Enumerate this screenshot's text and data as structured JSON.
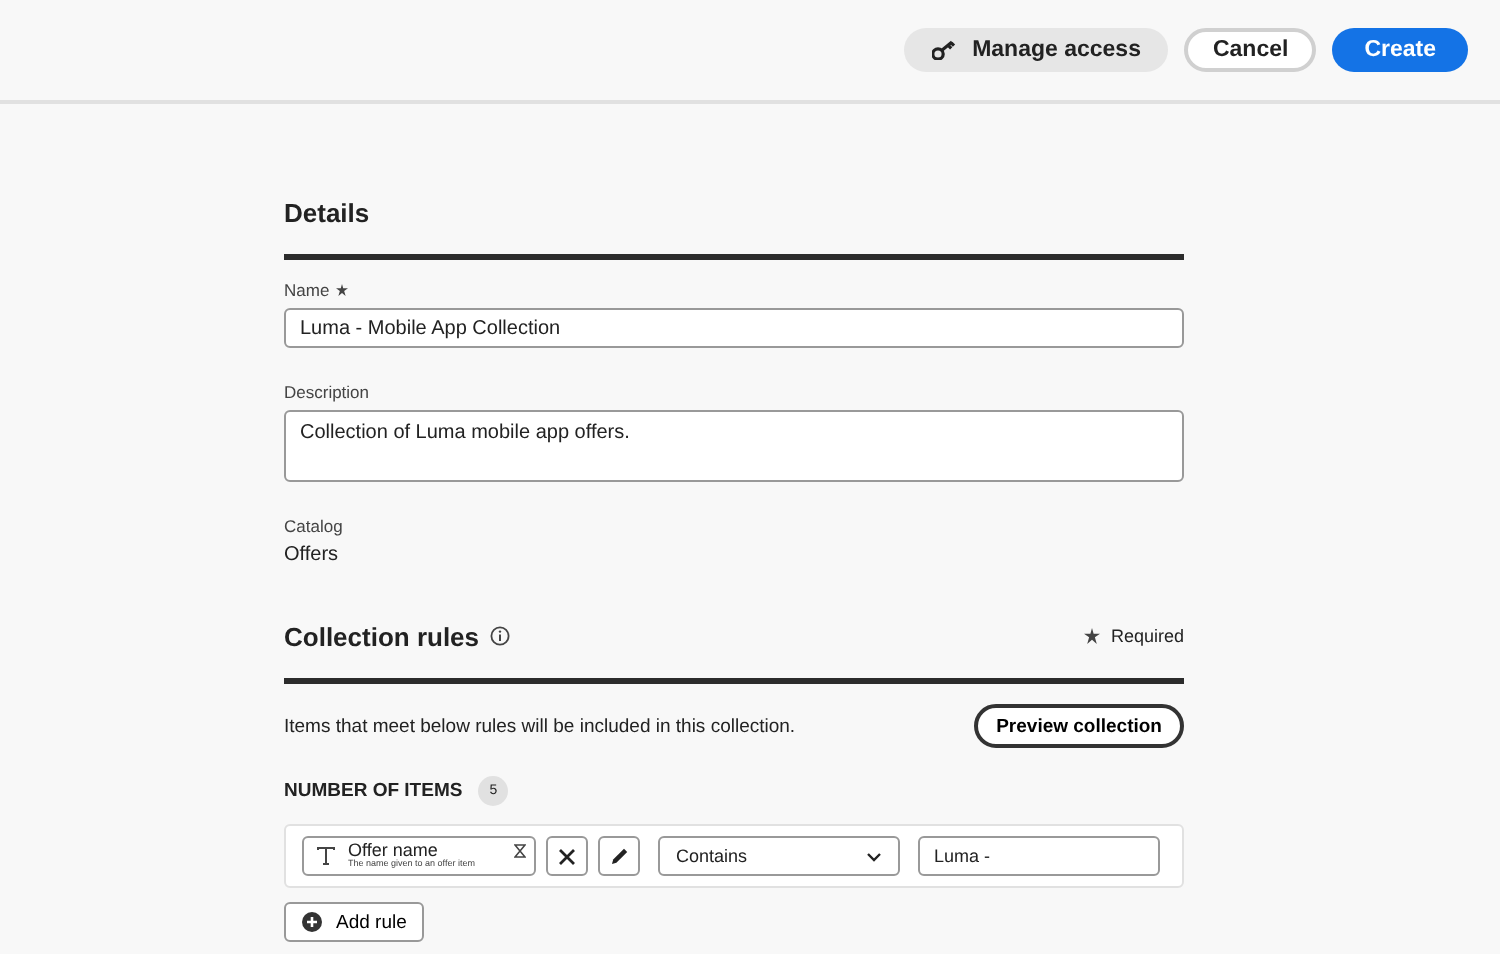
{
  "header": {
    "buttons": [
      {
        "label": "Manage access",
        "kind": "secondary"
      },
      {
        "label": "Cancel",
        "kind": "outline"
      },
      {
        "label": "Create",
        "kind": "primary"
      }
    ]
  },
  "details": {
    "title": "Details",
    "name": {
      "label": "Name",
      "required": true,
      "value": "Luma - Mobile App Collection"
    },
    "description": {
      "label": "Description",
      "required": false,
      "value": "Collection of Luma mobile app offers."
    },
    "catalog": {
      "label": "Catalog",
      "value": "Offers"
    }
  },
  "rules": {
    "title": "Collection rules",
    "required_note": "Required",
    "intro": "Items that meet below rules will be included in this collection.",
    "preview_button": "Preview collection",
    "count_label": "NUMBER OF ITEMS",
    "count": "5",
    "rule": {
      "attribute": "Offer name",
      "attribute_hint": "The name given to an offer item",
      "operator": "Contains",
      "value": "Luma -"
    },
    "add_button": "Add rule"
  }
}
